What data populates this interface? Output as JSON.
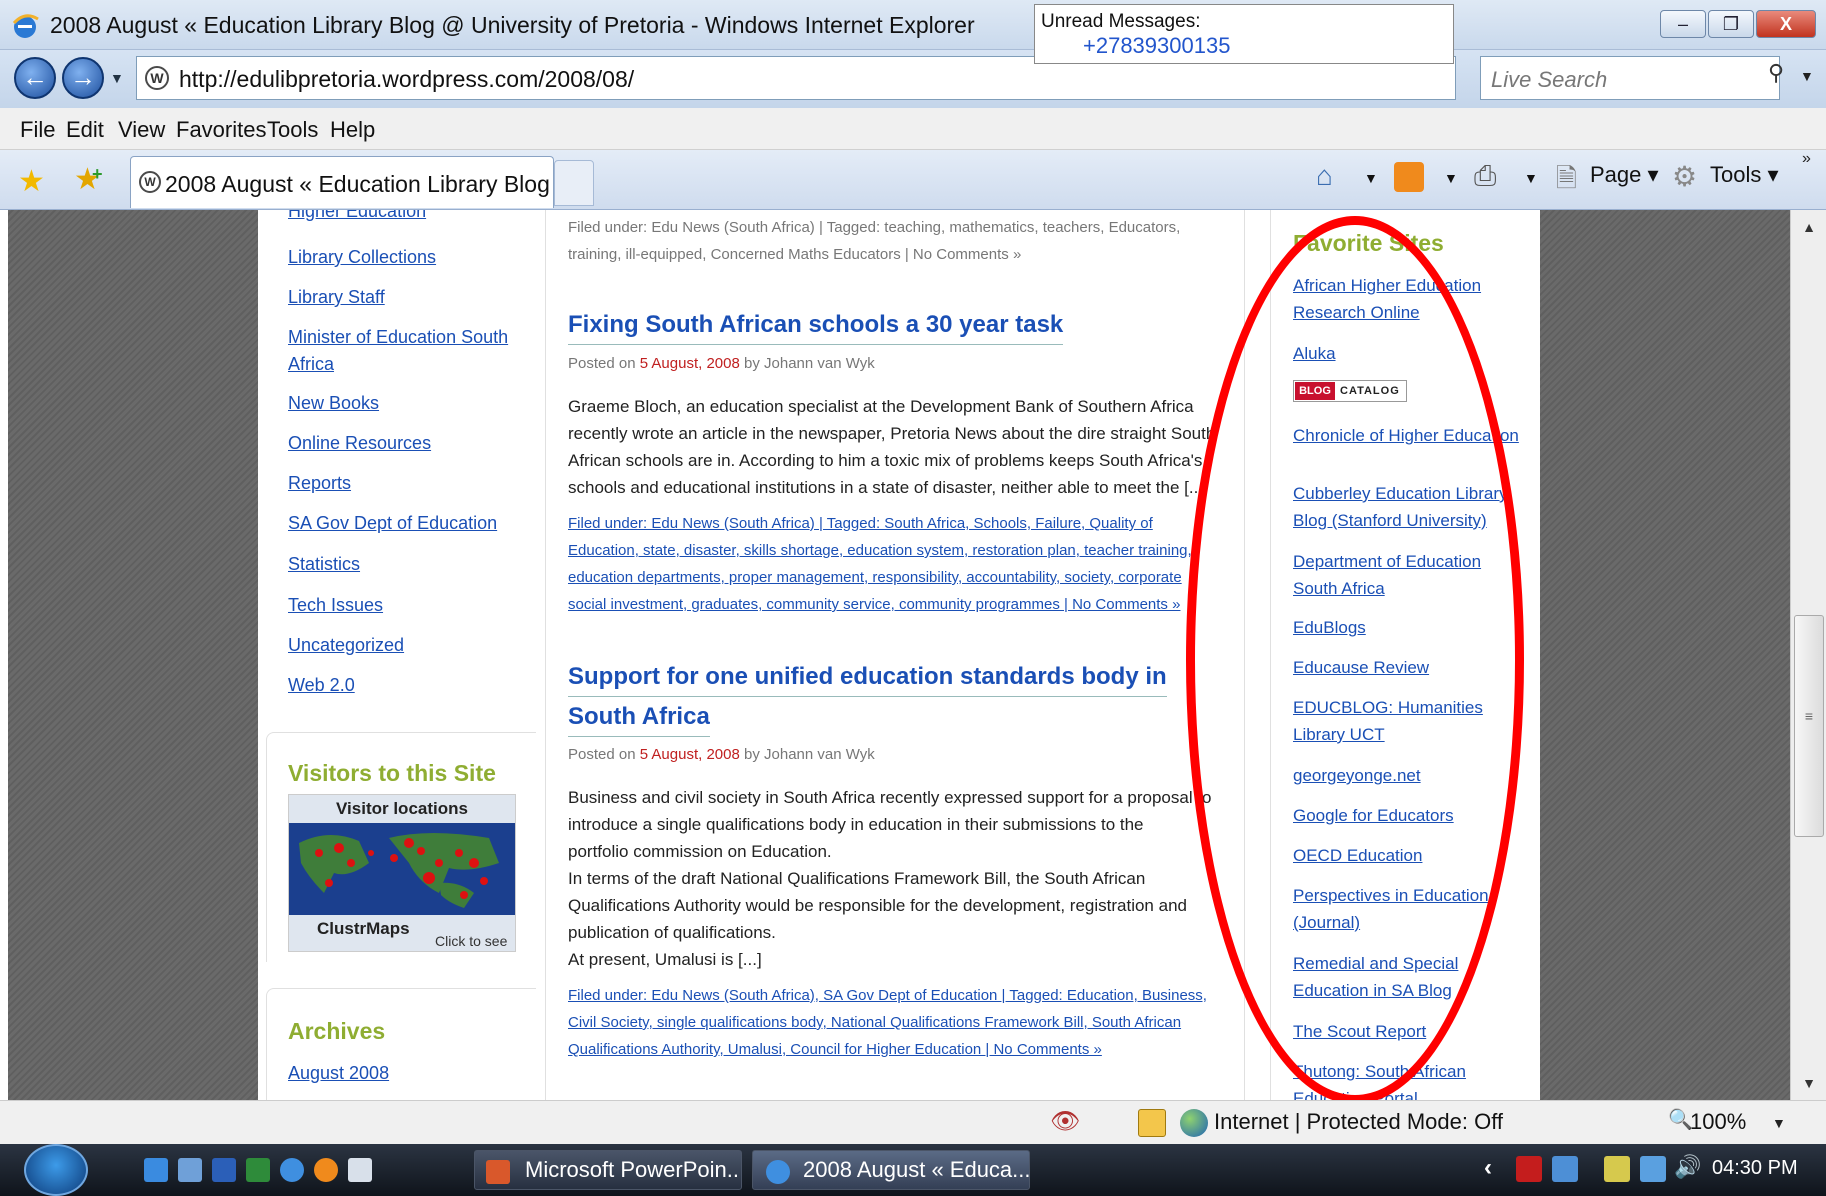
{
  "window": {
    "title": "2008 August « Education Library Blog @ University of Pretoria - Windows Internet Explorer",
    "controls": [
      "–",
      "❐",
      "X"
    ]
  },
  "notification": {
    "label": "Unread Messages:",
    "number": "+27839300135"
  },
  "address_bar": {
    "url": "http://edulibpretoria.wordpress.com/2008/08/",
    "search_placeholder": "Live Search"
  },
  "menu": [
    "File",
    "Edit",
    "View",
    "Favorites",
    "Tools",
    "Help"
  ],
  "tab": {
    "title": "2008 August « Education Library Blog ..."
  },
  "command_bar": {
    "page_label": "Page ▾",
    "tools_label": "Tools ▾"
  },
  "left_sidebar": {
    "categories": [
      "Higher Education",
      "Library Collections",
      "Library Staff",
      "Minister of Education South Africa",
      "New Books",
      "Online Resources",
      "Reports",
      "SA Gov Dept of Education",
      "Statistics",
      "Tech Issues",
      "Uncategorized",
      "Web 2.0"
    ],
    "visitors_title": "Visitors to this Site",
    "clustr": {
      "title": "Visitor locations",
      "brand": "ClustrMaps",
      "hint": "Click to see"
    },
    "archives_title": "Archives",
    "archives": [
      "August 2008"
    ]
  },
  "posts": {
    "top_meta_line1": "Filed under: Edu News (South Africa) | Tagged: teaching, mathematics, teachers, Educators,",
    "top_meta_line2": "training, ill-equipped, Concerned Maths Educators | No Comments »",
    "post1": {
      "title": "Fixing South African schools a 30 year task",
      "posted_prefix": "Posted on",
      "date": "5 August, 2008",
      "by": "by Johann van Wyk",
      "body": [
        "Graeme Bloch, an education specialist at the Development Bank of Southern Africa",
        "recently wrote an article in the newspaper, Pretoria News about the dire straight South",
        "African schools are in. According to him a  toxic mix of problems keeps South Africa's",
        "schools and educational institutions in a state of disaster, neither able to meet the [...]"
      ],
      "meta": [
        "Filed under: Edu News (South Africa) | Tagged: South Africa, Schools, Failure, Quality of",
        "Education, state, disaster, skills shortage, education system, restoration plan, teacher training,",
        "education departments, proper management, responsibility, accountability, society, corporate",
        "social investment, graduates, community service, community programmes | No Comments »"
      ]
    },
    "post2": {
      "title_line1": "Support for one unified education standards body in",
      "title_line2": "South Africa",
      "posted_prefix": "Posted on",
      "date": "5 August, 2008",
      "by": "by Johann van Wyk",
      "body": [
        "Business and civil society in South Africa recently expressed support for a proposal to",
        "introduce a single qualifications body in education in their submissions to the",
        "portfolio commission on Education.",
        "In terms of the draft National Qualifications Framework Bill, the South African",
        "Qualifications Authority would be responsible for the development, registration and",
        "publication of qualifications.",
        "At present, Umalusi is [...]"
      ],
      "meta": [
        "Filed under: Edu News (South Africa), SA Gov Dept of Education | Tagged: Education, Business,",
        "Civil Society, single qualifications body, National Qualifications Framework Bill, South African",
        "Qualifications Authority, Umalusi, Council for Higher Education | No Comments »"
      ]
    }
  },
  "right_sidebar": {
    "title": "Favorite Sites",
    "blogcatalog_a": "BLOG",
    "blogcatalog_b": "CATALOG",
    "links": [
      "African Higher Education Research Online",
      "Aluka",
      "Chronicle of Higher Education",
      "Cubberley Education Library Blog (Stanford University)",
      "Department of Education South Africa",
      "EduBlogs",
      "Educause Review",
      "EDUCBLOG: Humanities Library UCT",
      "georgeyonge.net",
      "Google for Educators",
      "OECD Education",
      "Perspectives in Education (Journal)",
      "Remedial and Special Education in SA Blog",
      "The Scout Report",
      "Thutong: South African Education Portal"
    ]
  },
  "status_bar": {
    "zone": "Internet | Protected Mode: Off",
    "zoom": "100%"
  },
  "taskbar": {
    "tasks": [
      "Microsoft PowerPoin...",
      "2008 August « Educa..."
    ],
    "clock": "04:30 PM"
  },
  "colors": {
    "link": "#1a4fb5",
    "widget_title": "#8fad32",
    "highlight": "#ff0000",
    "date": "#c02020"
  }
}
